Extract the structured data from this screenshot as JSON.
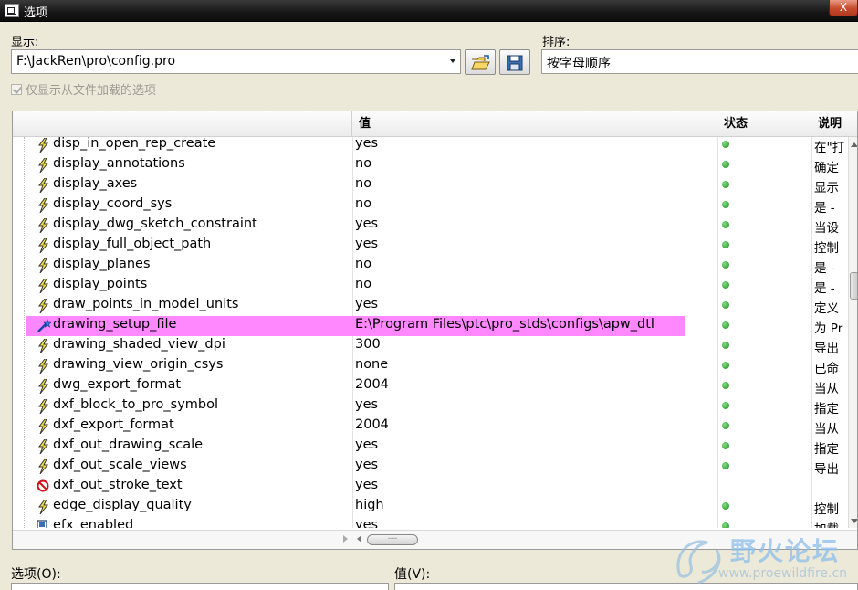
{
  "window": {
    "title": "选项",
    "close_label": "X"
  },
  "display_label": "显示:",
  "display_path": "F:\\JackRen\\pro\\config.pro",
  "sort_label": "排序:",
  "sort_value": "按字母顺序",
  "only_loaded_checkbox": "仅显示从文件加载的选项",
  "columns": {
    "value": "值",
    "status": "状态",
    "desc": "说明"
  },
  "rows": [
    {
      "name": "disp_in_open_rep_create",
      "value": "yes",
      "status": true,
      "desc": "在\"打",
      "icon": "lightning"
    },
    {
      "name": "display_annotations",
      "value": "no",
      "status": true,
      "desc": "确定",
      "icon": "lightning"
    },
    {
      "name": "display_axes",
      "value": "no",
      "status": true,
      "desc": "显示",
      "icon": "lightning"
    },
    {
      "name": "display_coord_sys",
      "value": "no",
      "status": true,
      "desc": "是 -",
      "icon": "lightning"
    },
    {
      "name": "display_dwg_sketch_constraint",
      "value": "yes",
      "status": true,
      "desc": "当设",
      "icon": "lightning"
    },
    {
      "name": "display_full_object_path",
      "value": "yes",
      "status": true,
      "desc": "控制",
      "icon": "lightning"
    },
    {
      "name": "display_planes",
      "value": "no",
      "status": true,
      "desc": "是 -",
      "icon": "lightning"
    },
    {
      "name": "display_points",
      "value": "no",
      "status": true,
      "desc": "是 -",
      "icon": "lightning"
    },
    {
      "name": "draw_points_in_model_units",
      "value": "yes",
      "status": true,
      "desc": "定义",
      "icon": "lightning"
    },
    {
      "name": "drawing_setup_file",
      "value": "E:\\Program Files\\ptc\\pro_stds\\configs\\apw_dtl",
      "status": true,
      "desc": "为 Pr",
      "icon": "wand",
      "highlight": true
    },
    {
      "name": "drawing_shaded_view_dpi",
      "value": "300",
      "status": true,
      "desc": "导出",
      "icon": "lightning"
    },
    {
      "name": "drawing_view_origin_csys",
      "value": "none",
      "status": true,
      "desc": "已命",
      "icon": "lightning"
    },
    {
      "name": "dwg_export_format",
      "value": "2004",
      "status": true,
      "desc": "当从",
      "icon": "lightning"
    },
    {
      "name": "dxf_block_to_pro_symbol",
      "value": "yes",
      "status": true,
      "desc": "指定",
      "icon": "lightning"
    },
    {
      "name": "dxf_export_format",
      "value": "2004",
      "status": true,
      "desc": "当从",
      "icon": "lightning"
    },
    {
      "name": "dxf_out_drawing_scale",
      "value": "yes",
      "status": true,
      "desc": "指定",
      "icon": "lightning"
    },
    {
      "name": "dxf_out_scale_views",
      "value": "yes",
      "status": true,
      "desc": "导出",
      "icon": "lightning"
    },
    {
      "name": "dxf_out_stroke_text",
      "value": "yes",
      "status": false,
      "desc": "",
      "icon": "no-entry"
    },
    {
      "name": "edge_display_quality",
      "value": "high",
      "status": true,
      "desc": "控制",
      "icon": "lightning"
    },
    {
      "name": "efx_enabled",
      "value": "yes",
      "status": true,
      "desc": "加载",
      "icon": "page"
    }
  ],
  "option_label": "选项(O):",
  "value_label": "值(V):",
  "watermark": {
    "text": "野火论坛",
    "url": "www.proewildfire.cn"
  },
  "colors": {
    "highlight": "#ff88ff",
    "status_ok": "#1f8f1f"
  }
}
